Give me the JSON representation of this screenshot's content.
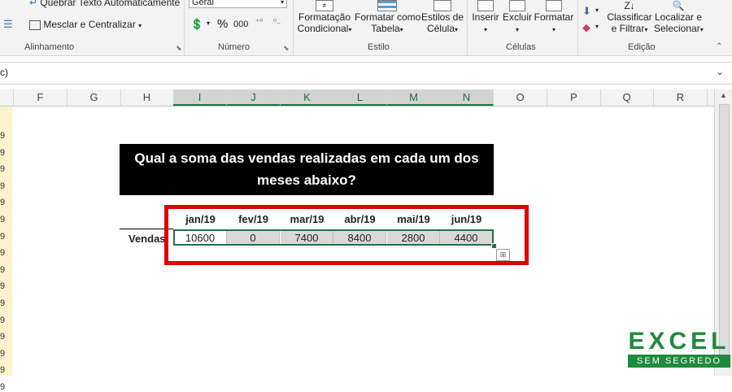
{
  "ribbon": {
    "alignment": {
      "wrap_text": "Quebrar Texto Automaticamente",
      "merge_center": "Mesclar e Centralizar",
      "label": "Alinhamento"
    },
    "number": {
      "format_value": "Geral",
      "percent_symbol": "%",
      "thousands_symbol": "000",
      "label": "Número"
    },
    "styles": {
      "conditional_line1": "Formatação",
      "conditional_line2": "Condicional",
      "format_table_line1": "Formatar como",
      "format_table_line2": "Tabela",
      "cell_styles_line1": "Estilos de",
      "cell_styles_line2": "Célula",
      "label": "Estilo"
    },
    "cells": {
      "insert": "Inserir",
      "delete": "Excluir",
      "format": "Formatar",
      "label": "Células"
    },
    "editing": {
      "sort_line1": "Classificar",
      "sort_line2": "e Filtrar",
      "find_line1": "Localizar e",
      "find_line2": "Selecionar",
      "label": "Edição"
    }
  },
  "formula_bar": {
    "fragment": "c)"
  },
  "columns": [
    "F",
    "G",
    "H",
    "I",
    "J",
    "K",
    "L",
    "M",
    "N",
    "O",
    "P",
    "Q",
    "R"
  ],
  "row_fragments": [
    "9",
    "9",
    "9",
    "9",
    "9",
    "9",
    "9",
    "9",
    "9",
    "9",
    "9",
    "9",
    "9",
    "9",
    "9",
    "9"
  ],
  "sheet": {
    "question": "Qual a soma das vendas realizadas em cada um dos meses abaixo?",
    "row_label": "Vendas",
    "months": [
      "jan/19",
      "fev/19",
      "mar/19",
      "abr/19",
      "mai/19",
      "jun/19"
    ],
    "values": [
      "10600",
      "0",
      "7400",
      "8400",
      "2800",
      "4400"
    ]
  },
  "colors": {
    "accent": "#217346",
    "highlight": "#e00000",
    "logo_green": "#1e8a3c"
  },
  "logo": {
    "line1": "EXCEL",
    "line2": "SEM SEGREDO"
  }
}
